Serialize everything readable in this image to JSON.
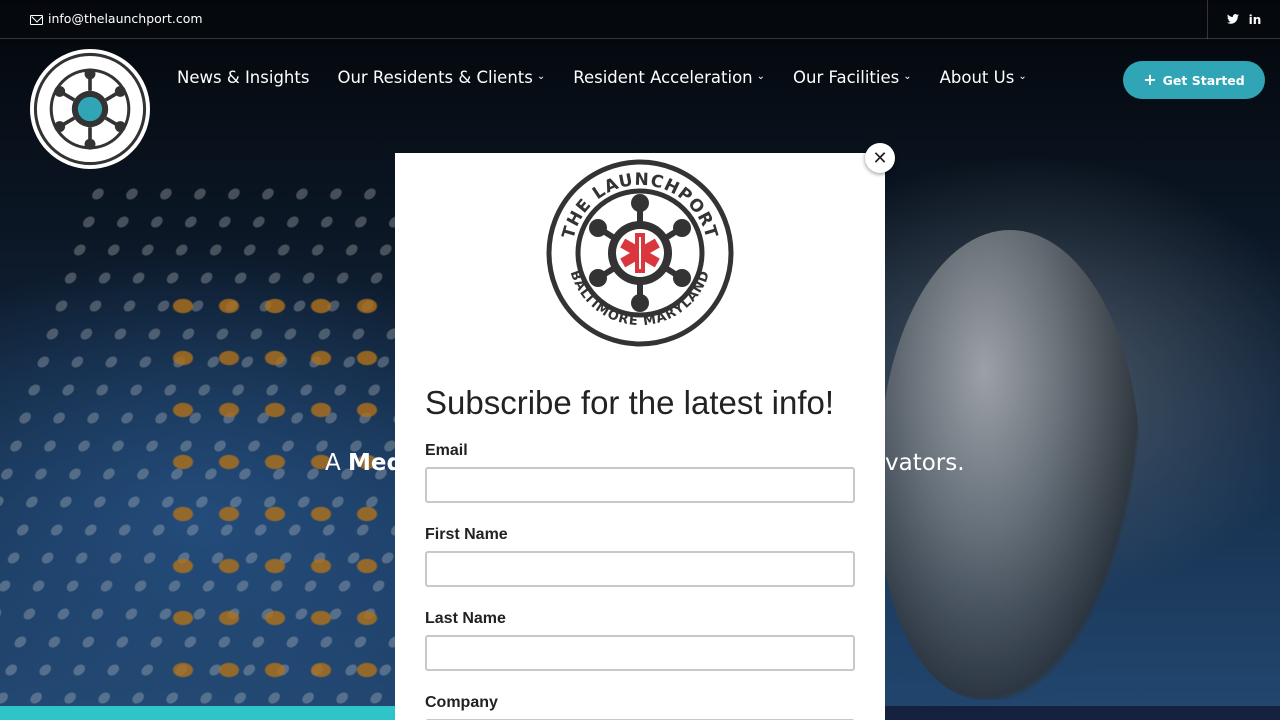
{
  "topbar": {
    "email": "info@thelaunchport.com",
    "social": [
      {
        "icon": "twitter-icon",
        "glyph": "🐦"
      },
      {
        "icon": "linkedin-icon",
        "glyph": "in"
      }
    ]
  },
  "header": {
    "logo_alt": "The Launchport Baltimore Maryland",
    "nav": [
      {
        "label": "News & Insights",
        "dropdown": false
      },
      {
        "label": "Our Residents & Clients",
        "dropdown": true
      },
      {
        "label": "Resident Acceleration",
        "dropdown": true
      },
      {
        "label": "Our Facilities",
        "dropdown": true
      },
      {
        "label": "About Us",
        "dropdown": true
      }
    ],
    "cta_label": "Get Started"
  },
  "hero": {
    "tagline_prefix": "A ",
    "tagline_bold": "Med",
    "tagline_suffix": "vators."
  },
  "modal": {
    "logo_text_top": "THE LAUNCHPORT",
    "logo_text_bottom": "BALTIMORE MARYLAND",
    "close_glyph": "✕",
    "title": "Subscribe for the latest info!",
    "fields": [
      {
        "label": "Email",
        "value": ""
      },
      {
        "label": "First Name",
        "value": ""
      },
      {
        "label": "Last Name",
        "value": ""
      },
      {
        "label": "Company",
        "value": ""
      }
    ]
  },
  "colors": {
    "accent": "#2fa5b6",
    "logo_dark": "#333333",
    "logo_red": "#d9363e",
    "strip_left": "#2ec4c8",
    "strip_right": "#14213f"
  }
}
